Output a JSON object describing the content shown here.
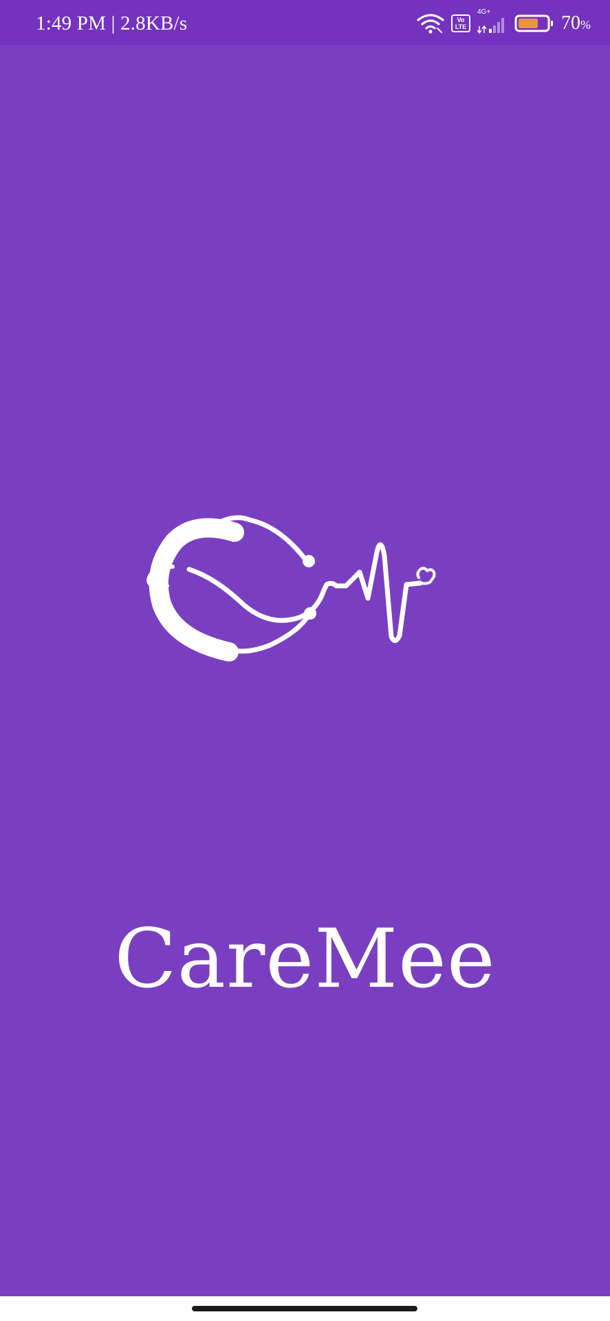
{
  "status_bar": {
    "time_speed": "1:49 PM | 2.8KB/s",
    "volte_label": "Vo\nLTE",
    "network_type": "4G+",
    "battery_percent": "70",
    "battery_unit": "%",
    "battery_level": 0.7,
    "battery_color": "#e8934a",
    "icons": [
      "wifi-icon",
      "volte-icon",
      "signal-icon",
      "battery-icon"
    ]
  },
  "splash": {
    "app_name": "CareMee",
    "logo": "caremee-stethoscope-heartbeat-logo"
  },
  "colors": {
    "background": "#7a3fc1",
    "status_bar": "#7532be",
    "foreground": "#ffffff"
  }
}
